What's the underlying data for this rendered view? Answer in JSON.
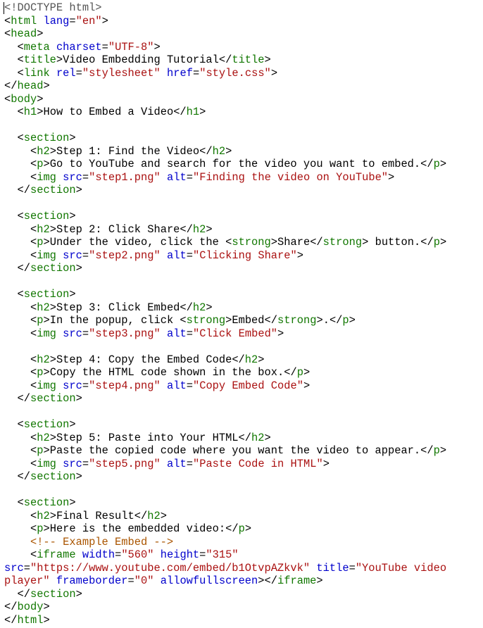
{
  "editor": {
    "colors": {
      "punct": "#000000",
      "tag": "#117700",
      "attr": "#0000cc",
      "str": "#aa1111",
      "text": "#000000",
      "comment": "#aa5500",
      "doctype": "#555555"
    },
    "lines": [
      [
        [
          "doctype",
          "<!DOCTYPE html>"
        ]
      ],
      [
        [
          "punct",
          "<"
        ],
        [
          "tag",
          "html"
        ],
        [
          "text",
          " "
        ],
        [
          "attr",
          "lang"
        ],
        [
          "punct",
          "="
        ],
        [
          "str",
          "\"en\""
        ],
        [
          "punct",
          ">"
        ]
      ],
      [
        [
          "punct",
          "<"
        ],
        [
          "tag",
          "head"
        ],
        [
          "punct",
          ">"
        ]
      ],
      [
        [
          "text",
          "  "
        ],
        [
          "punct",
          "<"
        ],
        [
          "tag",
          "meta"
        ],
        [
          "text",
          " "
        ],
        [
          "attr",
          "charset"
        ],
        [
          "punct",
          "="
        ],
        [
          "str",
          "\"UTF-8\""
        ],
        [
          "punct",
          ">"
        ]
      ],
      [
        [
          "text",
          "  "
        ],
        [
          "punct",
          "<"
        ],
        [
          "tag",
          "title"
        ],
        [
          "punct",
          ">"
        ],
        [
          "text",
          "Video Embedding Tutorial"
        ],
        [
          "punct",
          "</"
        ],
        [
          "tag",
          "title"
        ],
        [
          "punct",
          ">"
        ]
      ],
      [
        [
          "text",
          "  "
        ],
        [
          "punct",
          "<"
        ],
        [
          "tag",
          "link"
        ],
        [
          "text",
          " "
        ],
        [
          "attr",
          "rel"
        ],
        [
          "punct",
          "="
        ],
        [
          "str",
          "\"stylesheet\""
        ],
        [
          "text",
          " "
        ],
        [
          "attr",
          "href"
        ],
        [
          "punct",
          "="
        ],
        [
          "str",
          "\"style.css\""
        ],
        [
          "punct",
          ">"
        ]
      ],
      [
        [
          "punct",
          "</"
        ],
        [
          "tag",
          "head"
        ],
        [
          "punct",
          ">"
        ]
      ],
      [
        [
          "punct",
          "<"
        ],
        [
          "tag",
          "body"
        ],
        [
          "punct",
          ">"
        ]
      ],
      [
        [
          "text",
          "  "
        ],
        [
          "punct",
          "<"
        ],
        [
          "tag",
          "h1"
        ],
        [
          "punct",
          ">"
        ],
        [
          "text",
          "How to Embed a Video"
        ],
        [
          "punct",
          "</"
        ],
        [
          "tag",
          "h1"
        ],
        [
          "punct",
          ">"
        ]
      ],
      [],
      [
        [
          "text",
          "  "
        ],
        [
          "punct",
          "<"
        ],
        [
          "tag",
          "section"
        ],
        [
          "punct",
          ">"
        ]
      ],
      [
        [
          "text",
          "    "
        ],
        [
          "punct",
          "<"
        ],
        [
          "tag",
          "h2"
        ],
        [
          "punct",
          ">"
        ],
        [
          "text",
          "Step 1: Find the Video"
        ],
        [
          "punct",
          "</"
        ],
        [
          "tag",
          "h2"
        ],
        [
          "punct",
          ">"
        ]
      ],
      [
        [
          "text",
          "    "
        ],
        [
          "punct",
          "<"
        ],
        [
          "tag",
          "p"
        ],
        [
          "punct",
          ">"
        ],
        [
          "text",
          "Go to YouTube and search for the video you want to embed."
        ],
        [
          "punct",
          "</"
        ],
        [
          "tag",
          "p"
        ],
        [
          "punct",
          ">"
        ]
      ],
      [
        [
          "text",
          "    "
        ],
        [
          "punct",
          "<"
        ],
        [
          "tag",
          "img"
        ],
        [
          "text",
          " "
        ],
        [
          "attr",
          "src"
        ],
        [
          "punct",
          "="
        ],
        [
          "str",
          "\"step1.png\""
        ],
        [
          "text",
          " "
        ],
        [
          "attr",
          "alt"
        ],
        [
          "punct",
          "="
        ],
        [
          "str",
          "\"Finding the video on YouTube\""
        ],
        [
          "punct",
          ">"
        ]
      ],
      [
        [
          "text",
          "  "
        ],
        [
          "punct",
          "</"
        ],
        [
          "tag",
          "section"
        ],
        [
          "punct",
          ">"
        ]
      ],
      [],
      [
        [
          "text",
          "  "
        ],
        [
          "punct",
          "<"
        ],
        [
          "tag",
          "section"
        ],
        [
          "punct",
          ">"
        ]
      ],
      [
        [
          "text",
          "    "
        ],
        [
          "punct",
          "<"
        ],
        [
          "tag",
          "h2"
        ],
        [
          "punct",
          ">"
        ],
        [
          "text",
          "Step 2: Click Share"
        ],
        [
          "punct",
          "</"
        ],
        [
          "tag",
          "h2"
        ],
        [
          "punct",
          ">"
        ]
      ],
      [
        [
          "text",
          "    "
        ],
        [
          "punct",
          "<"
        ],
        [
          "tag",
          "p"
        ],
        [
          "punct",
          ">"
        ],
        [
          "text",
          "Under the video, click the "
        ],
        [
          "punct",
          "<"
        ],
        [
          "tag",
          "strong"
        ],
        [
          "punct",
          ">"
        ],
        [
          "text",
          "Share"
        ],
        [
          "punct",
          "</"
        ],
        [
          "tag",
          "strong"
        ],
        [
          "punct",
          ">"
        ],
        [
          "text",
          " button."
        ],
        [
          "punct",
          "</"
        ],
        [
          "tag",
          "p"
        ],
        [
          "punct",
          ">"
        ]
      ],
      [
        [
          "text",
          "    "
        ],
        [
          "punct",
          "<"
        ],
        [
          "tag",
          "img"
        ],
        [
          "text",
          " "
        ],
        [
          "attr",
          "src"
        ],
        [
          "punct",
          "="
        ],
        [
          "str",
          "\"step2.png\""
        ],
        [
          "text",
          " "
        ],
        [
          "attr",
          "alt"
        ],
        [
          "punct",
          "="
        ],
        [
          "str",
          "\"Clicking Share\""
        ],
        [
          "punct",
          ">"
        ]
      ],
      [
        [
          "text",
          "  "
        ],
        [
          "punct",
          "</"
        ],
        [
          "tag",
          "section"
        ],
        [
          "punct",
          ">"
        ]
      ],
      [],
      [
        [
          "text",
          "  "
        ],
        [
          "punct",
          "<"
        ],
        [
          "tag",
          "section"
        ],
        [
          "punct",
          ">"
        ]
      ],
      [
        [
          "text",
          "    "
        ],
        [
          "punct",
          "<"
        ],
        [
          "tag",
          "h2"
        ],
        [
          "punct",
          ">"
        ],
        [
          "text",
          "Step 3: Click Embed"
        ],
        [
          "punct",
          "</"
        ],
        [
          "tag",
          "h2"
        ],
        [
          "punct",
          ">"
        ]
      ],
      [
        [
          "text",
          "    "
        ],
        [
          "punct",
          "<"
        ],
        [
          "tag",
          "p"
        ],
        [
          "punct",
          ">"
        ],
        [
          "text",
          "In the popup, click "
        ],
        [
          "punct",
          "<"
        ],
        [
          "tag",
          "strong"
        ],
        [
          "punct",
          ">"
        ],
        [
          "text",
          "Embed"
        ],
        [
          "punct",
          "</"
        ],
        [
          "tag",
          "strong"
        ],
        [
          "punct",
          ">"
        ],
        [
          "text",
          "."
        ],
        [
          "punct",
          "</"
        ],
        [
          "tag",
          "p"
        ],
        [
          "punct",
          ">"
        ]
      ],
      [
        [
          "text",
          "    "
        ],
        [
          "punct",
          "<"
        ],
        [
          "tag",
          "img"
        ],
        [
          "text",
          " "
        ],
        [
          "attr",
          "src"
        ],
        [
          "punct",
          "="
        ],
        [
          "str",
          "\"step3.png\""
        ],
        [
          "text",
          " "
        ],
        [
          "attr",
          "alt"
        ],
        [
          "punct",
          "="
        ],
        [
          "str",
          "\"Click Embed\""
        ],
        [
          "punct",
          ">"
        ]
      ],
      [],
      [
        [
          "text",
          "    "
        ],
        [
          "punct",
          "<"
        ],
        [
          "tag",
          "h2"
        ],
        [
          "punct",
          ">"
        ],
        [
          "text",
          "Step 4: Copy the Embed Code"
        ],
        [
          "punct",
          "</"
        ],
        [
          "tag",
          "h2"
        ],
        [
          "punct",
          ">"
        ]
      ],
      [
        [
          "text",
          "    "
        ],
        [
          "punct",
          "<"
        ],
        [
          "tag",
          "p"
        ],
        [
          "punct",
          ">"
        ],
        [
          "text",
          "Copy the HTML code shown in the box."
        ],
        [
          "punct",
          "</"
        ],
        [
          "tag",
          "p"
        ],
        [
          "punct",
          ">"
        ]
      ],
      [
        [
          "text",
          "    "
        ],
        [
          "punct",
          "<"
        ],
        [
          "tag",
          "img"
        ],
        [
          "text",
          " "
        ],
        [
          "attr",
          "src"
        ],
        [
          "punct",
          "="
        ],
        [
          "str",
          "\"step4.png\""
        ],
        [
          "text",
          " "
        ],
        [
          "attr",
          "alt"
        ],
        [
          "punct",
          "="
        ],
        [
          "str",
          "\"Copy Embed Code\""
        ],
        [
          "punct",
          ">"
        ]
      ],
      [
        [
          "text",
          "  "
        ],
        [
          "punct",
          "</"
        ],
        [
          "tag",
          "section"
        ],
        [
          "punct",
          ">"
        ]
      ],
      [],
      [
        [
          "text",
          "  "
        ],
        [
          "punct",
          "<"
        ],
        [
          "tag",
          "section"
        ],
        [
          "punct",
          ">"
        ]
      ],
      [
        [
          "text",
          "    "
        ],
        [
          "punct",
          "<"
        ],
        [
          "tag",
          "h2"
        ],
        [
          "punct",
          ">"
        ],
        [
          "text",
          "Step 5: Paste into Your HTML"
        ],
        [
          "punct",
          "</"
        ],
        [
          "tag",
          "h2"
        ],
        [
          "punct",
          ">"
        ]
      ],
      [
        [
          "text",
          "    "
        ],
        [
          "punct",
          "<"
        ],
        [
          "tag",
          "p"
        ],
        [
          "punct",
          ">"
        ],
        [
          "text",
          "Paste the copied code where you want the video to appear."
        ],
        [
          "punct",
          "</"
        ],
        [
          "tag",
          "p"
        ],
        [
          "punct",
          ">"
        ]
      ],
      [
        [
          "text",
          "    "
        ],
        [
          "punct",
          "<"
        ],
        [
          "tag",
          "img"
        ],
        [
          "text",
          " "
        ],
        [
          "attr",
          "src"
        ],
        [
          "punct",
          "="
        ],
        [
          "str",
          "\"step5.png\""
        ],
        [
          "text",
          " "
        ],
        [
          "attr",
          "alt"
        ],
        [
          "punct",
          "="
        ],
        [
          "str",
          "\"Paste Code in HTML\""
        ],
        [
          "punct",
          ">"
        ]
      ],
      [
        [
          "text",
          "  "
        ],
        [
          "punct",
          "</"
        ],
        [
          "tag",
          "section"
        ],
        [
          "punct",
          ">"
        ]
      ],
      [],
      [
        [
          "text",
          "  "
        ],
        [
          "punct",
          "<"
        ],
        [
          "tag",
          "section"
        ],
        [
          "punct",
          ">"
        ]
      ],
      [
        [
          "text",
          "    "
        ],
        [
          "punct",
          "<"
        ],
        [
          "tag",
          "h2"
        ],
        [
          "punct",
          ">"
        ],
        [
          "text",
          "Final Result"
        ],
        [
          "punct",
          "</"
        ],
        [
          "tag",
          "h2"
        ],
        [
          "punct",
          ">"
        ]
      ],
      [
        [
          "text",
          "    "
        ],
        [
          "punct",
          "<"
        ],
        [
          "tag",
          "p"
        ],
        [
          "punct",
          ">"
        ],
        [
          "text",
          "Here is the embedded video:"
        ],
        [
          "punct",
          "</"
        ],
        [
          "tag",
          "p"
        ],
        [
          "punct",
          ">"
        ]
      ],
      [
        [
          "text",
          "    "
        ],
        [
          "comment",
          "<!-- Example Embed -->"
        ]
      ],
      [
        [
          "text",
          "    "
        ],
        [
          "punct",
          "<"
        ],
        [
          "tag",
          "iframe"
        ],
        [
          "text",
          " "
        ],
        [
          "attr",
          "width"
        ],
        [
          "punct",
          "="
        ],
        [
          "str",
          "\"560\""
        ],
        [
          "text",
          " "
        ],
        [
          "attr",
          "height"
        ],
        [
          "punct",
          "="
        ],
        [
          "str",
          "\"315\""
        ]
      ],
      [
        [
          "attr",
          "src"
        ],
        [
          "punct",
          "="
        ],
        [
          "str",
          "\"https://www.youtube.com/embed/b1OtvpAZkvk\""
        ],
        [
          "text",
          " "
        ],
        [
          "attr",
          "title"
        ],
        [
          "punct",
          "="
        ],
        [
          "str",
          "\"YouTube video"
        ]
      ],
      [
        [
          "str",
          "player\""
        ],
        [
          "text",
          " "
        ],
        [
          "attr",
          "frameborder"
        ],
        [
          "punct",
          "="
        ],
        [
          "str",
          "\"0\""
        ],
        [
          "text",
          " "
        ],
        [
          "attr",
          "allowfullscreen"
        ],
        [
          "punct",
          "></"
        ],
        [
          "tag",
          "iframe"
        ],
        [
          "punct",
          ">"
        ]
      ],
      [
        [
          "text",
          "  "
        ],
        [
          "punct",
          "</"
        ],
        [
          "tag",
          "section"
        ],
        [
          "punct",
          ">"
        ]
      ],
      [
        [
          "punct",
          "</"
        ],
        [
          "tag",
          "body"
        ],
        [
          "punct",
          ">"
        ]
      ],
      [
        [
          "punct",
          "</"
        ],
        [
          "tag",
          "html"
        ],
        [
          "punct",
          ">"
        ]
      ]
    ]
  }
}
